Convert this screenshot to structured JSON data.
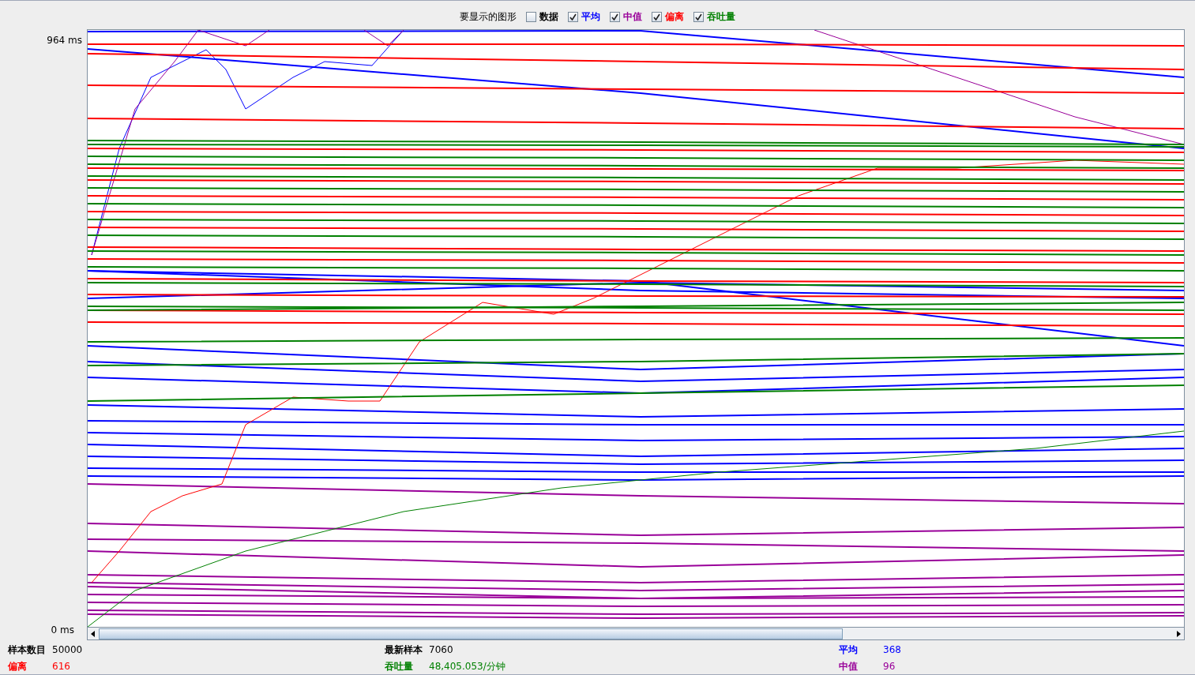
{
  "legend": {
    "title": "要显示的图形",
    "items": [
      {
        "label": "数据",
        "checked": false,
        "color": "#000000"
      },
      {
        "label": "平均",
        "checked": true,
        "color": "#0000ff"
      },
      {
        "label": "中值",
        "checked": true,
        "color": "#990099"
      },
      {
        "label": "偏离",
        "checked": true,
        "color": "#ff0000"
      },
      {
        "label": "吞吐量",
        "checked": true,
        "color": "#008000"
      }
    ]
  },
  "graph": {
    "y_max_label": "964 ms",
    "y_min_label": "0 ms"
  },
  "stats": [
    {
      "label": "样本数目",
      "value": "50000",
      "color": "#000000"
    },
    {
      "label": "最新样本",
      "value": "7060",
      "color": "#000000"
    },
    {
      "label": "平均",
      "value": "368",
      "color": "#0000ff"
    },
    {
      "label": "偏离",
      "value": "616",
      "color": "#ff0000"
    },
    {
      "label": "吞吐量",
      "value": "48,405.053/分钟",
      "color": "#008000"
    },
    {
      "label": "中值",
      "value": "96",
      "color": "#990099"
    }
  ]
}
